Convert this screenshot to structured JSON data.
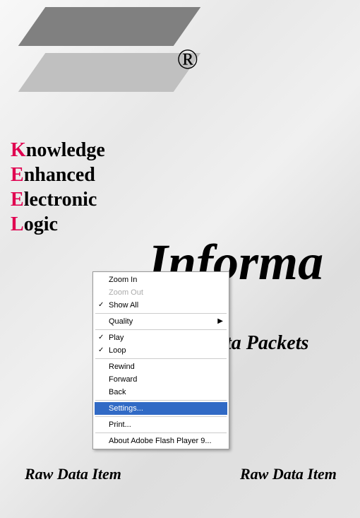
{
  "logo": {
    "brand": "KEEL",
    "trademark": "®"
  },
  "acronym": {
    "lines": [
      {
        "first": "K",
        "rest": "nowledge"
      },
      {
        "first": "E",
        "rest": "nhanced"
      },
      {
        "first": "E",
        "rest": "lectronic"
      },
      {
        "first": "L",
        "rest": "ogic"
      }
    ]
  },
  "background_text": {
    "informa": "Informa",
    "packets": "ta Packets",
    "raw_left": "Raw Data Item",
    "raw_right": "Raw Data Item"
  },
  "context_menu": {
    "zoom_in": "Zoom In",
    "zoom_out": "Zoom Out",
    "show_all": "Show All",
    "quality": "Quality",
    "play": "Play",
    "loop": "Loop",
    "rewind": "Rewind",
    "forward": "Forward",
    "back": "Back",
    "settings": "Settings...",
    "print": "Print...",
    "about": "About Adobe Flash Player 9..."
  }
}
